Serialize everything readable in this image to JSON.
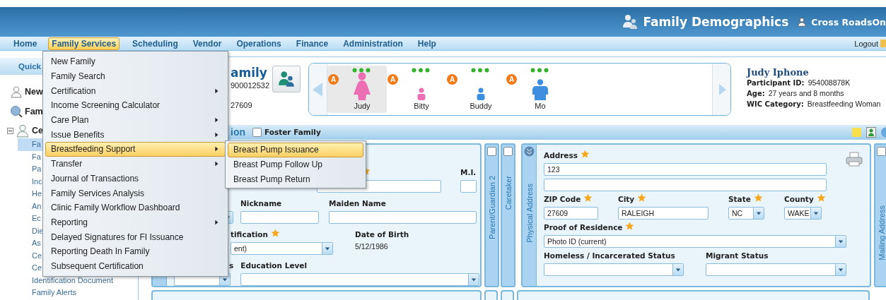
{
  "banner": {
    "title": "Family Demographics",
    "user": "Cross RoadsOn"
  },
  "menu_bar": {
    "items": [
      {
        "label": "Home",
        "selected": false
      },
      {
        "label": "Family Services",
        "selected": true
      },
      {
        "label": "Scheduling",
        "selected": false
      },
      {
        "label": "Vendor",
        "selected": false
      },
      {
        "label": "Operations",
        "selected": false
      },
      {
        "label": "Finance",
        "selected": false
      },
      {
        "label": "Administration",
        "selected": false
      },
      {
        "label": "Help",
        "selected": false
      }
    ],
    "logout": "Logout"
  },
  "sidebar": {
    "header": "Quick",
    "links": [
      {
        "label": "New",
        "kind": "person"
      },
      {
        "label": "Fam",
        "kind": "search"
      }
    ],
    "tree": {
      "label": "Ce",
      "expanded": true,
      "children": [
        {
          "label": "Fa",
          "selected": true
        },
        {
          "label": "Fa",
          "selected": false
        },
        {
          "label": "Pa",
          "selected": false
        },
        {
          "label": "Inc",
          "selected": false
        },
        {
          "label": "He",
          "selected": false
        },
        {
          "label": "An",
          "selected": false
        },
        {
          "label": "Ec",
          "selected": false
        },
        {
          "label": "Die",
          "selected": false
        },
        {
          "label": "As",
          "selected": false
        },
        {
          "label": "Ce",
          "selected": false
        },
        {
          "label": "Ce",
          "selected": false
        },
        {
          "label": "Identification Document",
          "selected": false
        },
        {
          "label": "Family Alerts",
          "selected": false
        }
      ]
    }
  },
  "family": {
    "name": "amily",
    "id": "900012532",
    "zip": "27609"
  },
  "participants": [
    {
      "name": "Judy",
      "badge": "A",
      "kind": "woman",
      "color": "#ec6fb4",
      "selected": true
    },
    {
      "name": "Bitty",
      "badge": "A",
      "kind": "child",
      "color": "#ec6fb4",
      "selected": false
    },
    {
      "name": "Buddy",
      "badge": "A",
      "kind": "child",
      "color": "#3f8fe0",
      "selected": false
    },
    {
      "name": "Mo",
      "badge": "A",
      "kind": "man",
      "color": "#3f8fe0",
      "selected": false
    }
  ],
  "participant_info": {
    "name": "Judy Iphone",
    "fields": [
      {
        "label": "Participant ID:",
        "value": "954008878K"
      },
      {
        "label": "Age:",
        "value": "27 years and 8 months"
      },
      {
        "label": "WIC Category:",
        "value": "Breastfeeding Woman"
      }
    ]
  },
  "section": {
    "title": "ion",
    "foster_family": {
      "label": "Foster Family",
      "checked": false
    }
  },
  "name_form": {
    "fields": [
      {
        "kind": "input",
        "required": true
      },
      {
        "kind": "input",
        "label": "M.I."
      },
      {
        "kind": "select"
      },
      {
        "kind": "input",
        "label": "Nickname"
      },
      {
        "kind": "input",
        "label": "Maiden Name"
      },
      {
        "kind": "select",
        "label": "tification",
        "required": true,
        "value": "ent)"
      },
      {
        "kind": "text",
        "label": "Date of Birth",
        "value": "5/12/1986"
      },
      {
        "kind": "select",
        "label": "s"
      },
      {
        "kind": "select",
        "label": "Education Level"
      }
    ]
  },
  "side_tabs": [
    {
      "label": "Parent/Guardian 2",
      "checked": false
    },
    {
      "label": "Caretaker",
      "checked": false
    }
  ],
  "physical_address": {
    "tab": "Physical Address",
    "fields": [
      {
        "kind": "input",
        "label": "Address",
        "required": true,
        "value": "123"
      },
      {
        "kind": "input"
      },
      {
        "kind": "input",
        "label": "ZIP Code",
        "required": true,
        "value": "27609"
      },
      {
        "kind": "input",
        "label": "City",
        "required": true,
        "value": "RALEIGH"
      },
      {
        "kind": "select",
        "label": "State",
        "required": true,
        "value": "NC"
      },
      {
        "kind": "select",
        "label": "County",
        "required": true,
        "value": "WAKE"
      },
      {
        "kind": "select",
        "label": "Proof of Residence",
        "required": true,
        "value": "Photo ID (current)"
      },
      {
        "kind": "select",
        "label": "Homeless / Incarcerated Status"
      },
      {
        "kind": "select",
        "label": "Migrant Status"
      }
    ]
  },
  "mailing_tab": {
    "label": "Mailing Address",
    "checked": false
  },
  "menu": {
    "items": [
      {
        "label": "New Family",
        "submenu": false,
        "selected": false
      },
      {
        "label": "Family Search",
        "submenu": false,
        "selected": false
      },
      {
        "label": "Certification",
        "submenu": true,
        "selected": false
      },
      {
        "label": "Income Screening Calculator",
        "submenu": false,
        "selected": false
      },
      {
        "label": "Care Plan",
        "submenu": true,
        "selected": false
      },
      {
        "label": "Issue Benefits",
        "submenu": true,
        "selected": false
      },
      {
        "label": "Breastfeeding Support",
        "submenu": true,
        "selected": true
      },
      {
        "label": "Transfer",
        "submenu": true,
        "selected": false
      },
      {
        "label": "Journal of Transactions",
        "submenu": false,
        "selected": false
      },
      {
        "label": "Family Services Analysis",
        "submenu": false,
        "selected": false
      },
      {
        "label": "Clinic Family Workflow Dashboard",
        "submenu": false,
        "selected": false
      },
      {
        "label": "Reporting",
        "submenu": true,
        "selected": false
      },
      {
        "label": "Delayed Signatures for FI Issuance",
        "submenu": false,
        "selected": false
      },
      {
        "label": "Reporting Death In Family",
        "submenu": false,
        "selected": false
      },
      {
        "label": "Subsequent Certification",
        "submenu": false,
        "selected": false
      }
    ]
  },
  "submenu": {
    "items": [
      {
        "label": "Breast Pump Issuance",
        "selected": true
      },
      {
        "label": "Breast Pump Follow Up",
        "selected": false
      },
      {
        "label": "Breast Pump Return",
        "selected": false
      }
    ]
  }
}
